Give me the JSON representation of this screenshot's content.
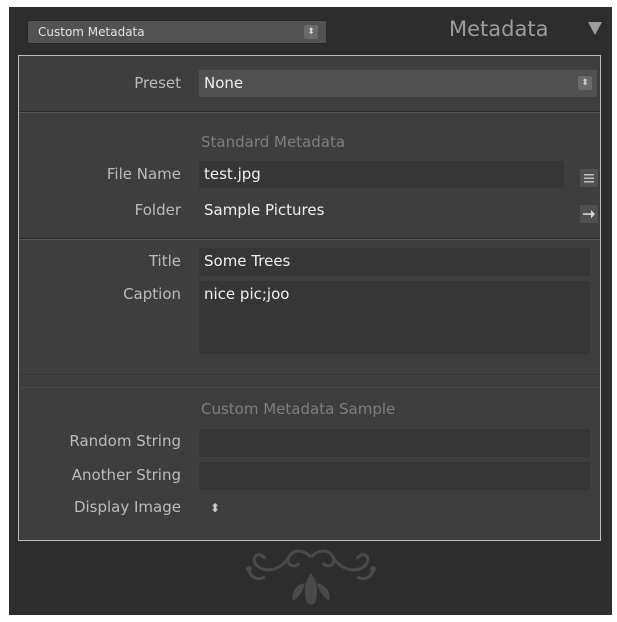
{
  "header": {
    "preset_menu_value": "Custom Metadata",
    "title": "Metadata"
  },
  "preset": {
    "label": "Preset",
    "value": "None"
  },
  "standard": {
    "heading": "Standard Metadata",
    "file_name_label": "File Name",
    "file_name_value": "test.jpg",
    "folder_label": "Folder",
    "folder_value": "Sample Pictures"
  },
  "content": {
    "title_label": "Title",
    "title_value": "Some Trees",
    "caption_label": "Caption",
    "caption_value": "nice pic;joo"
  },
  "custom": {
    "heading": "Custom Metadata Sample",
    "random_string_label": "Random String",
    "random_string_value": "",
    "another_string_label": "Another String",
    "another_string_value": "",
    "display_image_label": "Display Image"
  },
  "icons": {
    "updown": "updown-arrows-icon",
    "list": "list-icon",
    "goto": "go-to-folder-arrow-icon",
    "collapse": "collapse-triangle-icon",
    "ornament": "end-panel-ornament"
  },
  "colors": {
    "panel_bg": "#2d2d2d",
    "box_bg": "#3e3e3e",
    "field_bg": "#363636",
    "label_text": "#bcbcbc",
    "section_text": "#7e7e7e"
  }
}
